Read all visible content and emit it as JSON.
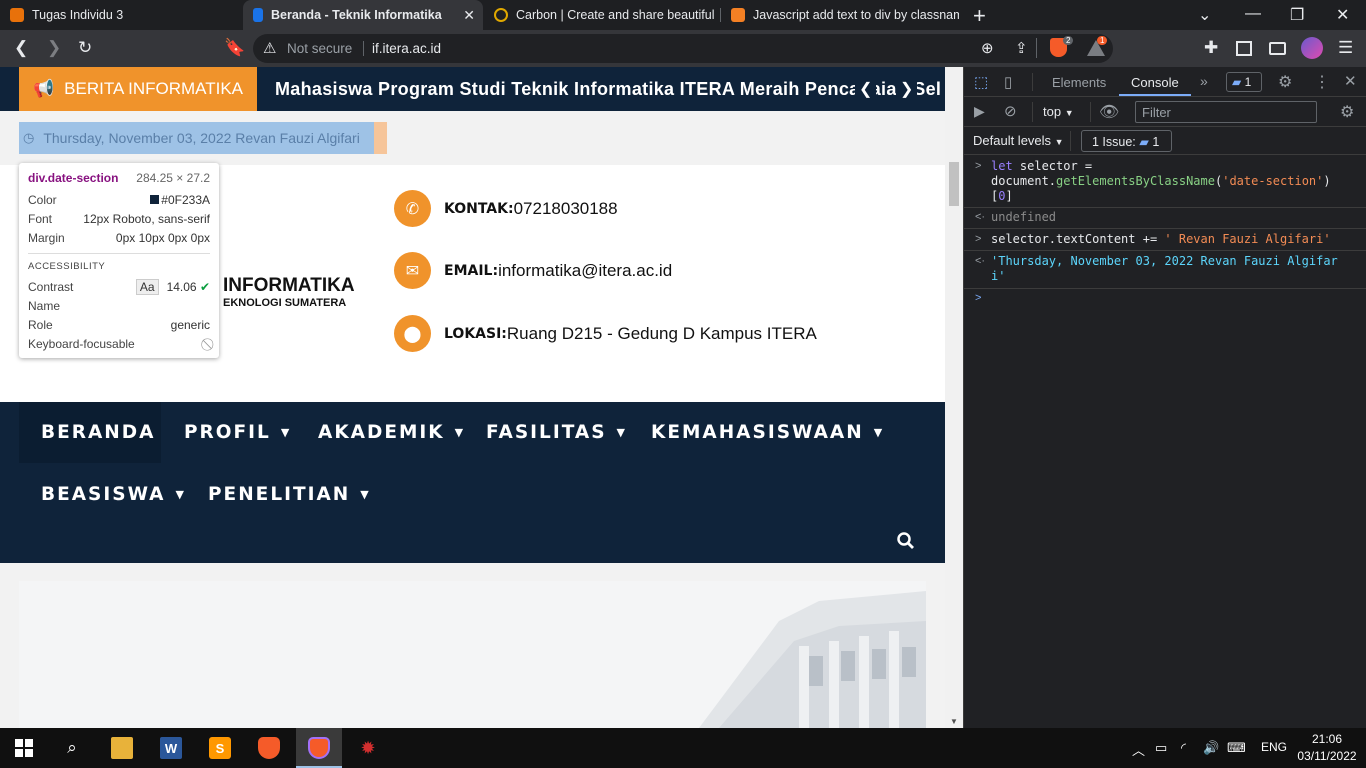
{
  "browser": {
    "tabs": [
      {
        "title": "Tugas Individu 3",
        "active": false,
        "favicon_color": "#e8710a"
      },
      {
        "title": "Beranda - Teknik Informatika",
        "active": true,
        "favicon_color": "#1a73e8"
      },
      {
        "title": "Carbon | Create and share beautiful im",
        "active": false,
        "favicon_color": "#e0a800"
      },
      {
        "title": "Javascript add text to div by classname",
        "active": false,
        "favicon_color": "#f48024"
      }
    ],
    "new_tab": "+",
    "security_label": "Not secure",
    "url": "if.itera.ac.id",
    "brave_shield_count": "2",
    "brave_rewards_count": "1"
  },
  "page": {
    "ticker_label": "BERITA INFORMATIKA",
    "ticker_text": "Mahasiswa Program Studi Teknik Informatika ITERA Meraih Pencapaian Sel",
    "date_text": "Thursday, November 03, 2022 Revan Fauzi Algifari",
    "logo_line1": "INFORMATIKA",
    "logo_line2": "EKNOLOGI SUMATERA",
    "contacts": [
      {
        "label": "KONTAK:",
        "value": "07218030188",
        "icon": "phone-icon"
      },
      {
        "label": "EMAIL:",
        "value": "informatika@itera.ac.id",
        "icon": "envelope-icon"
      },
      {
        "label": "LOKASI:",
        "value": "Ruang D215 - Gedung D Kampus ITERA",
        "icon": "location-pin-icon"
      }
    ],
    "nav": [
      "BERANDA",
      "PROFIL",
      "AKADEMIK",
      "FASILITAS",
      "KEMAHASISWAAN",
      "BEASISWA",
      "PENELITIAN"
    ],
    "accent_color": "#f0932b",
    "navy_color": "#0f233a"
  },
  "tooltip": {
    "selector": "div.date-section",
    "size": "284.25 × 27.2",
    "color_label": "Color",
    "color_value": "#0F233A",
    "font_label": "Font",
    "font_value": "12px Roboto, sans-serif",
    "margin_label": "Margin",
    "margin_value": "0px 10px 0px 0px",
    "accessibility_heading": "ACCESSIBILITY",
    "contrast_label": "Contrast",
    "contrast_aa": "Aa",
    "contrast_value": "14.06",
    "name_label": "Name",
    "role_label": "Role",
    "role_value": "generic",
    "keyboard_label": "Keyboard-focusable"
  },
  "devtools": {
    "tabs": [
      "Elements",
      "Console"
    ],
    "active_tab": "Console",
    "messages_badge": "1",
    "context": "top",
    "filter_placeholder": "Filter",
    "levels": "Default levels",
    "issues": "1 Issue:",
    "issues_count": "1",
    "console": {
      "l1_kw": "let",
      "l1_rest": " selector =",
      "l2_a": "document.",
      "l2_fn": "getElementsByClassName",
      "l2_b": "(",
      "l2_str": "'date-section'",
      "l2_c": ")",
      "l3_a": "[",
      "l3_num": "0",
      "l3_b": "]",
      "undefined": "undefined",
      "l4_a": "selector.textContent += ",
      "l4_str": "' Revan Fauzi Algifari'",
      "out1": "'Thursday, November 03, 2022 Revan Fauzi Algifar",
      "out2": "i'"
    }
  },
  "taskbar": {
    "lang": "ENG",
    "time": "21:06",
    "date": "03/11/2022"
  }
}
